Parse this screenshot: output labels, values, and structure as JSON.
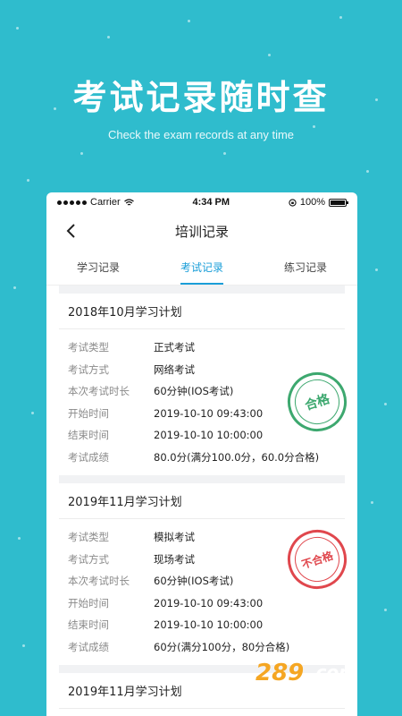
{
  "hero": {
    "title": "考试记录随时查",
    "subtitle": "Check the exam records at any time"
  },
  "status_bar": {
    "carrier": "Carrier",
    "time": "4:34 PM",
    "battery": "100%"
  },
  "nav": {
    "title": "培训记录"
  },
  "tabs": [
    {
      "label": "学习记录",
      "active": false
    },
    {
      "label": "考试记录",
      "active": true
    },
    {
      "label": "练习记录",
      "active": false
    }
  ],
  "records": [
    {
      "title": "2018年10月学习计划",
      "stamp": "合格",
      "fields": [
        {
          "key": "考试类型",
          "value": "正式考试"
        },
        {
          "key": "考试方式",
          "value": "网络考试"
        },
        {
          "key": "本次考试时长",
          "value": "60分钟(IOS考试)"
        },
        {
          "key": "开始时间",
          "value": "2019-10-10 09:43:00"
        },
        {
          "key": "结束时间",
          "value": "2019-10-10 10:00:00"
        },
        {
          "key": "考试成绩",
          "value": "80.0分(满分100.0分，60.0分合格)"
        }
      ]
    },
    {
      "title": "2019年11月学习计划",
      "stamp": "不合格",
      "fields": [
        {
          "key": "考试类型",
          "value": "模拟考试"
        },
        {
          "key": "考试方式",
          "value": "现场考试"
        },
        {
          "key": "本次考试时长",
          "value": "60分钟(IOS考试)"
        },
        {
          "key": "开始时间",
          "value": "2019-10-10 09:43:00"
        },
        {
          "key": "结束时间",
          "value": "2019-10-10 10:00:00"
        },
        {
          "key": "考试成绩",
          "value": "60分(满分100分，80分合格)"
        }
      ]
    },
    {
      "title": "2019年11月学习计划"
    }
  ],
  "watermark": {
    "text": "289.com 手游网"
  },
  "colors": {
    "background": "#2fbccd",
    "accent": "#1a9ed8",
    "pass": "#3da86f",
    "fail": "#e0474d"
  }
}
